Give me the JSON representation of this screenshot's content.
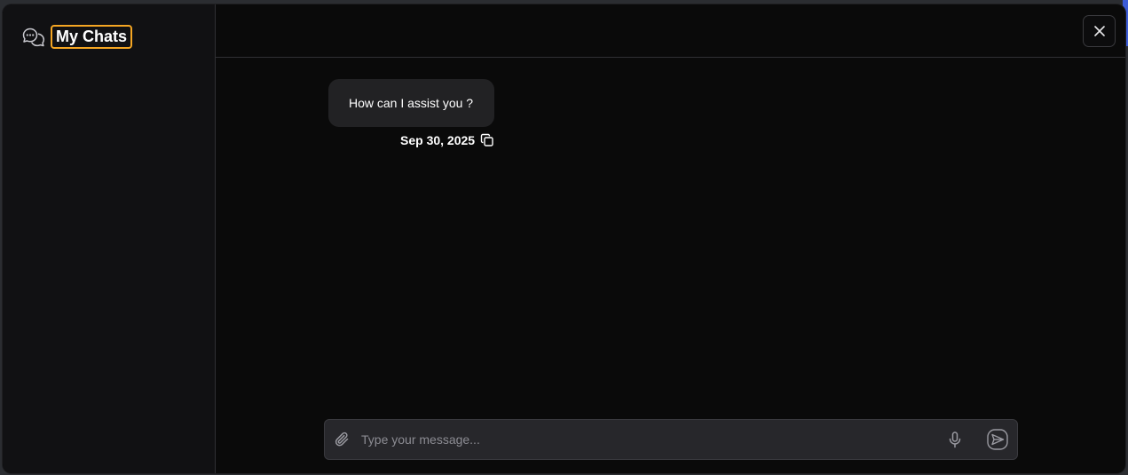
{
  "sidebar": {
    "title": "My Chats",
    "icon": "chat-bubbles-icon"
  },
  "header": {
    "close_icon": "close-icon"
  },
  "messages": [
    {
      "text": "How can I assist you ?",
      "date": "Sep 30, 2025",
      "action_icon": "copy-icon"
    }
  ],
  "composer": {
    "placeholder": "Type your message...",
    "value": "",
    "attach_icon": "paperclip-icon",
    "mic_icon": "microphone-icon",
    "send_icon": "send-icon"
  },
  "colors": {
    "highlight_border": "#f5a623",
    "modal_bg": "#0a0a0a",
    "sidebar_bg": "#111113",
    "bubble_bg": "#222224",
    "accent_strip": "#3b5bd6"
  }
}
